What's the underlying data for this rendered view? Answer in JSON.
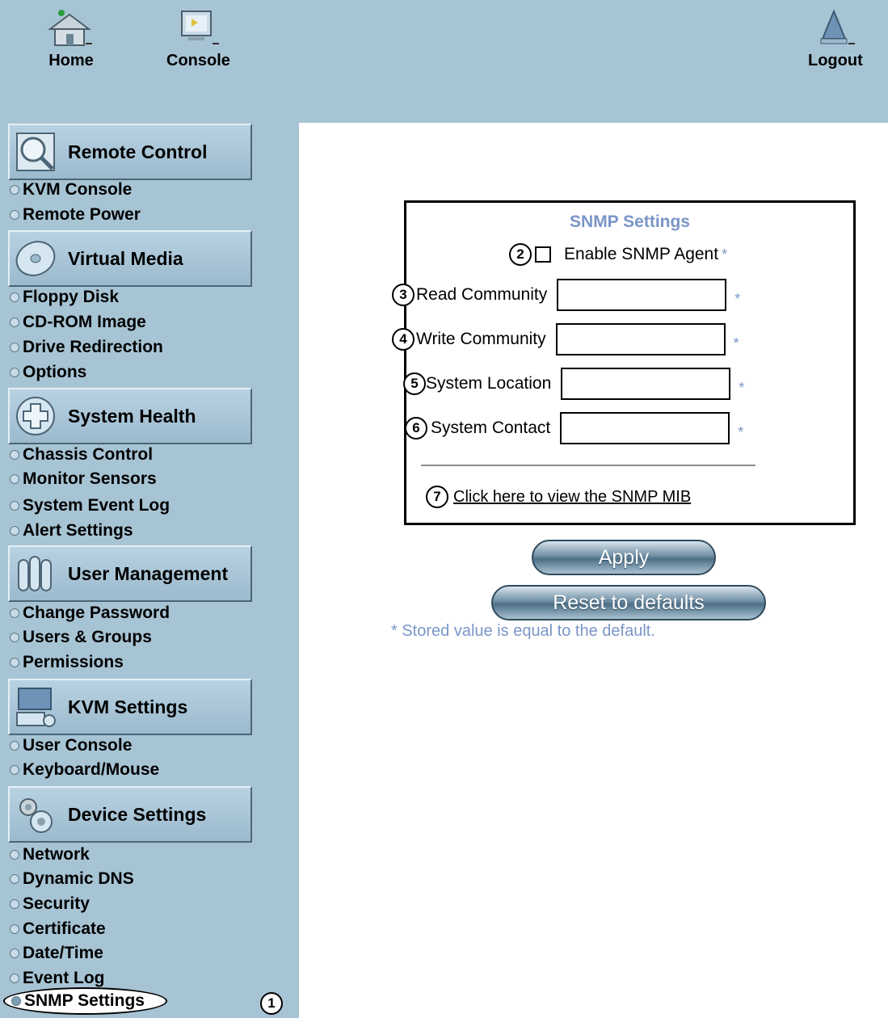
{
  "topbar": {
    "home_label": "Home",
    "console_label": "Console",
    "logout_label": "Logout"
  },
  "sidebar": {
    "sections": [
      {
        "title": "Remote Control",
        "icon": "magnifier-icon",
        "items": [
          "KVM Console",
          "Remote Power"
        ]
      },
      {
        "title": "Virtual Media",
        "icon": "disc-icon",
        "items": [
          "Floppy Disk",
          "CD-ROM Image",
          "Drive Redirection",
          "Options"
        ]
      },
      {
        "title": "System Health",
        "icon": "health-cross-icon",
        "items": [
          "Chassis Control",
          "Monitor Sensors",
          "System Event Log",
          "Alert Settings"
        ]
      },
      {
        "title": "User Management",
        "icon": "users-icon",
        "items": [
          "Change Password",
          "Users & Groups",
          "Permissions"
        ]
      },
      {
        "title": "KVM Settings",
        "icon": "keyboard-monitor-icon",
        "items": [
          "User Console",
          "Keyboard/Mouse"
        ]
      },
      {
        "title": "Device Settings",
        "icon": "gears-icon",
        "items": [
          "Network",
          "Dynamic DNS",
          "Security",
          "Certificate",
          "Date/Time",
          "Event Log",
          "SNMP Settings"
        ]
      }
    ],
    "active_item": "SNMP Settings"
  },
  "callouts": [
    "1",
    "2",
    "3",
    "4",
    "5",
    "6",
    "7"
  ],
  "snmp": {
    "title": "SNMP Settings",
    "enable_label": "Enable SNMP Agent",
    "enable_checked": false,
    "star": "*",
    "fields": [
      {
        "label": "Read Community",
        "value": ""
      },
      {
        "label": "Write Community",
        "value": ""
      },
      {
        "label": "System Location",
        "value": ""
      },
      {
        "label": "System Contact",
        "value": ""
      }
    ],
    "mib_link": "Click here to view the SNMP MIB"
  },
  "buttons": {
    "apply": "Apply",
    "reset": "Reset to defaults"
  },
  "note": "* Stored value is equal to the default.",
  "colors": {
    "sidebar_bg": "#a7c4d4",
    "accent_text": "#7a96c8"
  }
}
